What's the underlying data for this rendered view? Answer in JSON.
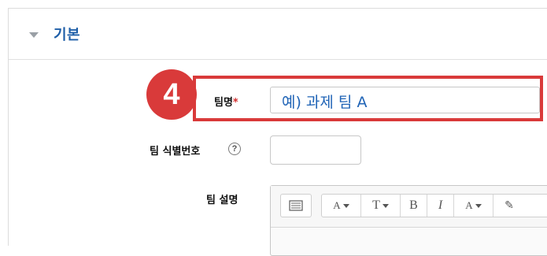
{
  "section": {
    "title": "기본"
  },
  "step_badge": "4",
  "fields": {
    "team_name": {
      "label": "팀명",
      "required_mark": "*",
      "value": "예) 과제 팀 A"
    },
    "team_id": {
      "label": "팀 식별번호",
      "help": "?",
      "value": ""
    },
    "team_description": {
      "label": "팀 설명"
    }
  },
  "toolbar": {
    "font_family": "A",
    "font_size": "T",
    "bold": "B",
    "italic": "I",
    "font_color": "A",
    "highlight": "✎"
  },
  "icons": [
    "chevron-down-icon",
    "help-icon",
    "toolbar-toggle-icon"
  ],
  "colors": {
    "accent": "#1f5fa8",
    "highlight_red": "#d93a3a",
    "required": "#d32f2f"
  }
}
